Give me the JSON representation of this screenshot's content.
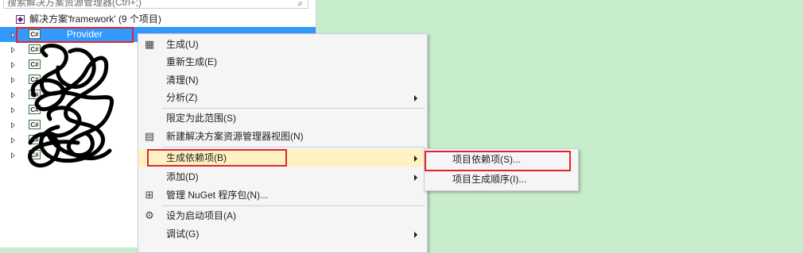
{
  "search": {
    "placeholder": "搜索解决方案资源管理器(Ctrl+;)"
  },
  "tree": {
    "solution_label": "解决方案'framework' (9 个项目)",
    "projects": [
      {
        "icon": "C#",
        "name": "Provider"
      },
      {
        "icon": "C#",
        "name": ""
      },
      {
        "icon": "C#",
        "name": ""
      },
      {
        "icon": "C#",
        "name": ""
      },
      {
        "icon": "C#",
        "name": ""
      },
      {
        "icon": "C#",
        "name": ""
      },
      {
        "icon": "C#",
        "name": ""
      },
      {
        "icon": "C#",
        "name": ""
      },
      {
        "icon": "C#",
        "name": ""
      }
    ]
  },
  "context_menu": {
    "items": [
      {
        "label": "生成(U)",
        "icon": "build-icon"
      },
      {
        "label": "重新生成(E)"
      },
      {
        "label": "清理(N)"
      },
      {
        "label": "分析(Z)",
        "submenu": true
      },
      {
        "label": "限定为此范围(S)"
      },
      {
        "label": "新建解决方案资源管理器视图(N)",
        "icon": "new-view-icon"
      },
      {
        "label": "生成依赖项(B)",
        "submenu": true,
        "highlighted": true
      },
      {
        "label": "添加(D)",
        "submenu": true
      },
      {
        "label": "管理 NuGet 程序包(N)...",
        "icon": "nuget-icon"
      },
      {
        "label": "设为启动项目(A)",
        "icon": "gear-icon"
      },
      {
        "label": "调试(G)",
        "submenu": true
      }
    ]
  },
  "submenu": {
    "items": [
      {
        "label": "项目依赖项(S)..."
      },
      {
        "label": "项目生成顺序(I)..."
      }
    ]
  },
  "colors": {
    "background": "#c7edcc",
    "selection": "#3399ff",
    "highlight": "#fff2c2",
    "annotation": "#e0252e"
  }
}
